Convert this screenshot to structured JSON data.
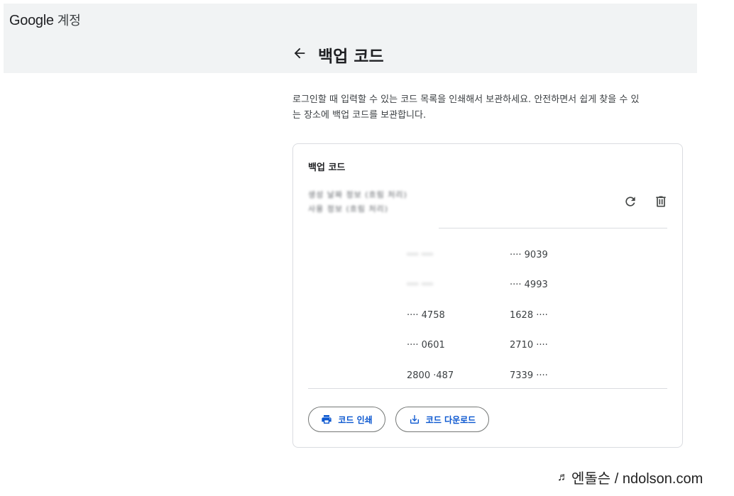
{
  "header": {
    "brand_google": "Google",
    "brand_account": "계정",
    "page_title": "백업 코드"
  },
  "description": "로그인할 때 입력할 수 있는 코드 목록을 인쇄해서 보관하세요. 안전하면서 쉽게 찾을 수 있는 장소에 백업 코드를 보관합니다.",
  "card": {
    "title": "백업 코드",
    "meta_line1": "생성 날짜 정보 (흐림 처리)",
    "meta_line2": "사용 정보 (흐림 처리)",
    "codes": [
      [
        "···· ····",
        "···· 9039"
      ],
      [
        "···· ····",
        "···· 4993"
      ],
      [
        "···· 4758",
        "1628 ····"
      ],
      [
        "···· 0601",
        "2710 ····"
      ],
      [
        "2800 ·487",
        "7339 ····"
      ]
    ],
    "print_label": "코드 인쇄",
    "download_label": "코드 다운로드"
  },
  "watermark": {
    "note": "♬",
    "text": "엔돌슨 / ndolson.com"
  },
  "colors": {
    "header_bg": "#f1f3f4",
    "accent": "#0b57d0",
    "border": "#dadce0"
  },
  "icons": [
    "back-arrow-icon",
    "refresh-icon",
    "trash-icon",
    "printer-icon",
    "download-icon"
  ]
}
